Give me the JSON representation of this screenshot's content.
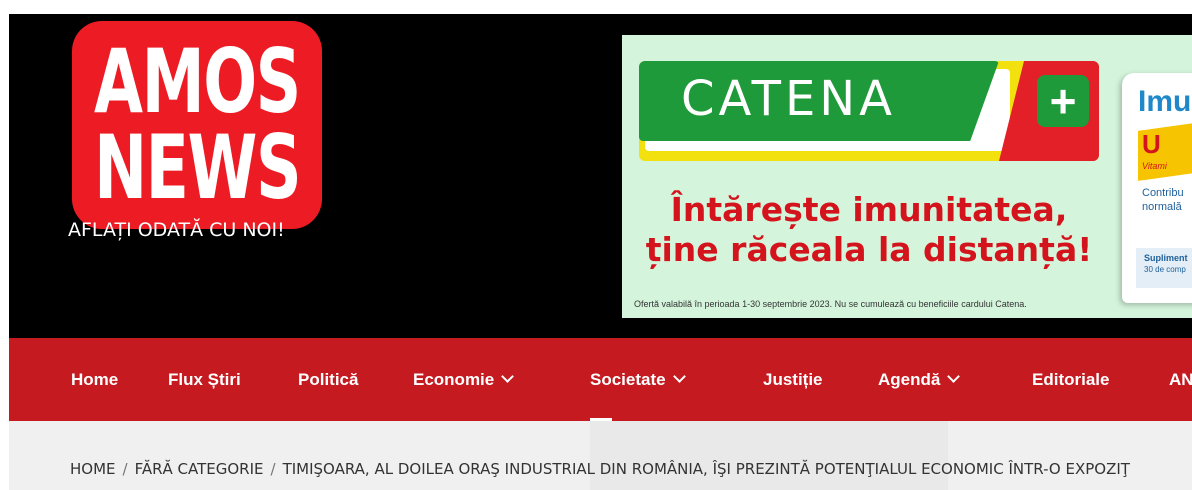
{
  "site": {
    "logo_line1": "AMOS",
    "logo_line2": "NEWS",
    "tagline": "AFLAȚI ODATĂ CU NOI!",
    "logo_color": "#ed1c24"
  },
  "ad": {
    "brand": "CATENA",
    "plus_symbol": "+",
    "headline_line1": "Întărește imunitatea,",
    "headline_line2": "ține răceala la distanță!",
    "fine_print": "Ofertă valabilă în perioada 1-30 septembrie 2023. Nu se cumulează cu beneficiile cardului Catena.",
    "product_title": "Imu",
    "product_sub": "U",
    "product_small": "Vitami",
    "product_text1": "Contribu",
    "product_text2": "normală",
    "product_supp": "Supliment",
    "product_supp2": "30 de comp",
    "background_color": "#d4f5dc",
    "brand_green": "#1f9a3a",
    "headline_color": "#d4141c"
  },
  "nav": {
    "items": [
      {
        "label": "Home",
        "has_dropdown": false
      },
      {
        "label": "Flux Știri",
        "has_dropdown": false
      },
      {
        "label": "Politică",
        "has_dropdown": false
      },
      {
        "label": "Economie",
        "has_dropdown": true,
        "icon": "chevron-down-icon"
      },
      {
        "label": "Societate",
        "has_dropdown": true,
        "icon": "chevron-down-icon"
      },
      {
        "label": "Justiție",
        "has_dropdown": false
      },
      {
        "label": "Agendă",
        "has_dropdown": true,
        "icon": "chevron-down-icon"
      },
      {
        "label": "Editoriale",
        "has_dropdown": false
      },
      {
        "label": "AN",
        "has_dropdown": false
      }
    ],
    "background_color": "#c41a20"
  },
  "breadcrumb": {
    "items": [
      "HOME",
      "FĂRĂ CATEGORIE",
      "TIMIŞOARA, AL DOILEA ORAŞ INDUSTRIAL DIN ROMÂNIA, ÎŞI PREZINTĂ POTENŢIALUL ECONOMIC ÎNTR-O EXPOZIŢ"
    ],
    "separator": "/"
  }
}
